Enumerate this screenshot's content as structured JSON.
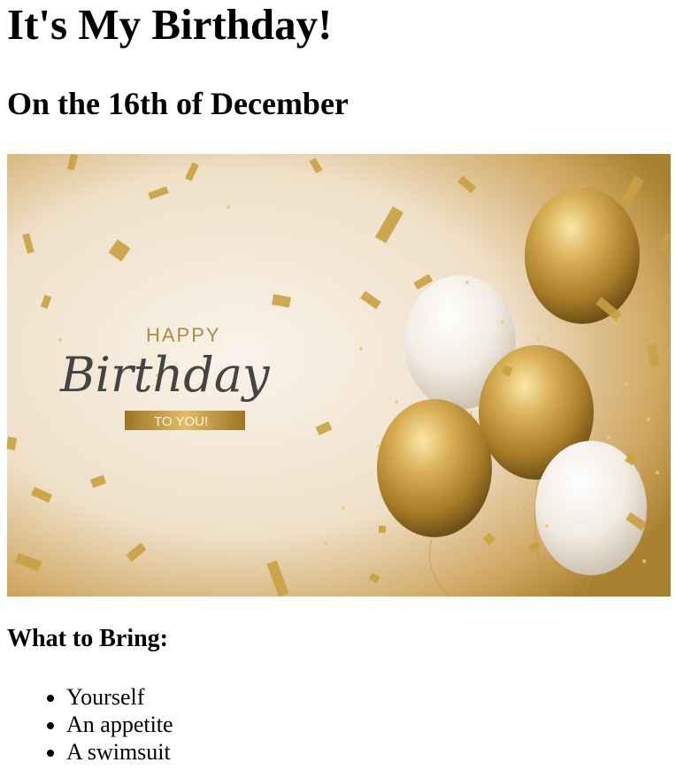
{
  "page": {
    "title": "It's My Birthday!",
    "subtitle": "On the 16th of December",
    "bring_heading": "What to Bring:",
    "bring_items": [
      "Yourself",
      "An appetite",
      "A swimsuit"
    ]
  },
  "hero_image": {
    "line1": "HAPPY",
    "line2": "Birthday",
    "line3": "TO YOU!",
    "colors": {
      "background": "#f3e6d2",
      "gold": "#c49a3c",
      "gold_dark": "#8f6a1f",
      "gold_light": "#f1d583",
      "white_balloon": "#f4efe8"
    }
  }
}
